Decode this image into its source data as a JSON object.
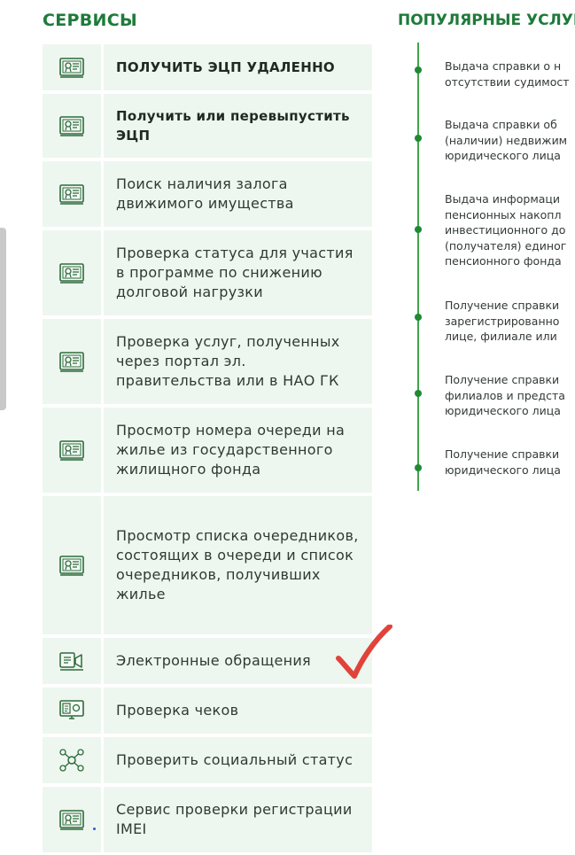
{
  "services": {
    "title": "СЕРВИСЫ",
    "items": [
      {
        "label": "ПОЛУЧИТЬ ЭЦП УДАЛЕННО",
        "icon": "certificate-icon",
        "bold": true
      },
      {
        "label": "Получить или перевыпустить ЭЦП",
        "icon": "certificate-icon",
        "bold": true
      },
      {
        "label": "Поиск наличия залога движимого имущества",
        "icon": "certificate-icon",
        "bold": false
      },
      {
        "label": "Проверка статуса для участия в программе по снижению долговой нагрузки",
        "icon": "certificate-icon",
        "bold": false
      },
      {
        "label": "Проверка услуг, полученных через портал эл. правительства или в НАО ГК",
        "icon": "certificate-icon",
        "bold": false
      },
      {
        "label": "Просмотр номера очереди на жилье из государственного жилищного фонда",
        "icon": "certificate-icon",
        "bold": false
      },
      {
        "label": "Просмотр списка очередников, состоящих в очереди и список очередников, получивших жилье",
        "icon": "certificate-icon",
        "bold": false
      },
      {
        "label": "Электронные обращения",
        "icon": "megaphone-icon",
        "bold": false
      },
      {
        "label": "Проверка чеков",
        "icon": "receipt-monitor-icon",
        "bold": false
      },
      {
        "label": "Проверить социальный статус",
        "icon": "social-network-icon",
        "bold": false
      },
      {
        "label": "Сервис проверки регистрации IMEI",
        "icon": "certificate-icon",
        "bold": false
      }
    ]
  },
  "popular": {
    "title": "ПОПУЛЯРНЫЕ УСЛУГ",
    "items": [
      {
        "lines": [
          "Выдача справки о н",
          "отсутствии судимост"
        ]
      },
      {
        "lines": [
          "Выдача справки об",
          "(наличии) недвижим",
          "юридического лица"
        ]
      },
      {
        "lines": [
          "Выдача информаци",
          "пенсионных накопл",
          "инвестиционного до",
          "(получателя) единог",
          "пенсионного фонда"
        ]
      },
      {
        "lines": [
          "Получение справки",
          "зарегистрированно",
          "лице, филиале или"
        ]
      },
      {
        "lines": [
          "Получение справки",
          "филиалов и предста",
          "юридического лица"
        ]
      },
      {
        "lines": [
          "Получение справки",
          "юридического лица"
        ]
      }
    ]
  },
  "colors": {
    "accent": "#1f7a3a",
    "tile_bg": "#eef6f0",
    "checkmark": "#e0433a"
  }
}
